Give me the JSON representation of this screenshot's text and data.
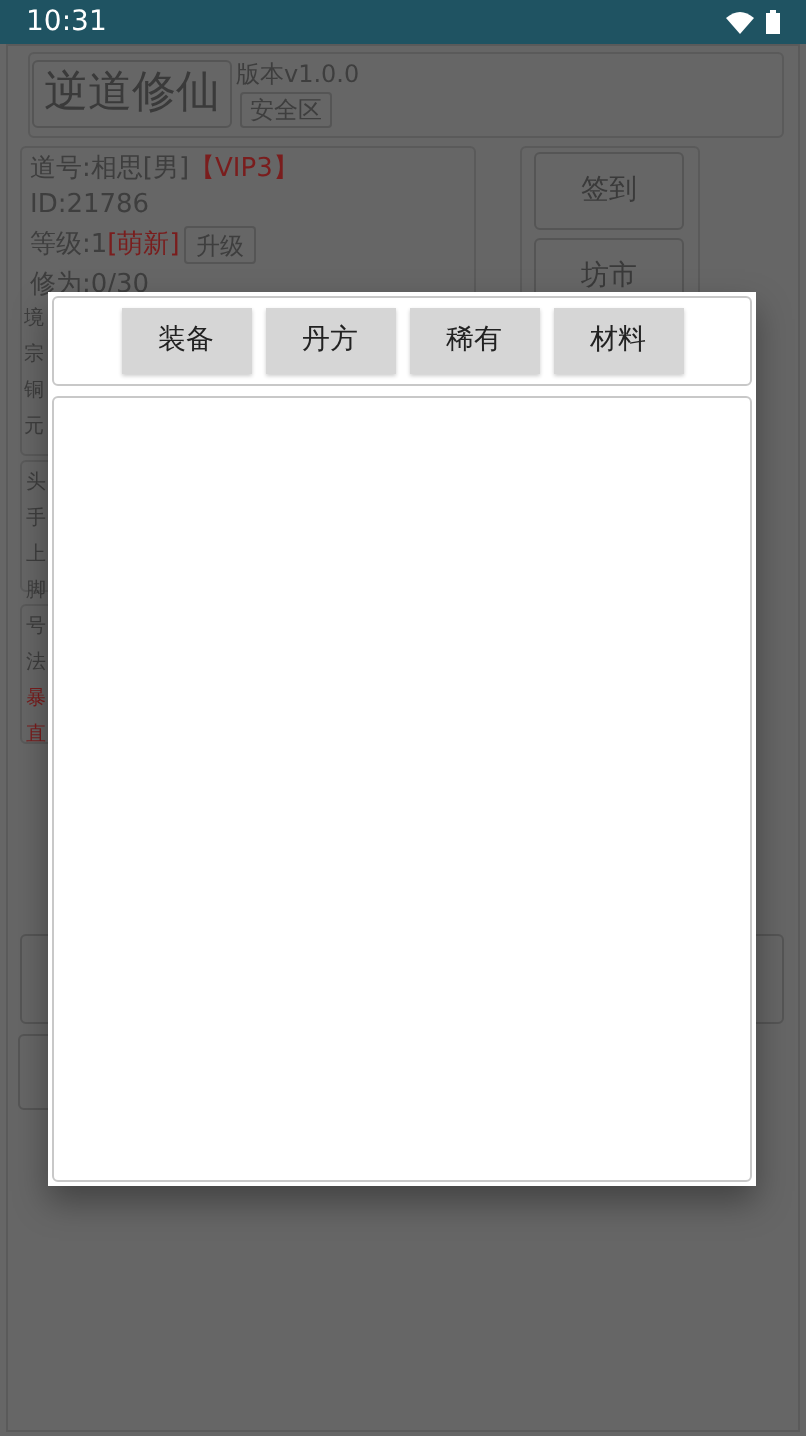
{
  "status_bar": {
    "time": "10:31"
  },
  "header": {
    "title": "逆道修仙",
    "version": "版本v1.0.0",
    "zone_button": "安全区"
  },
  "profile": {
    "name": "道号:相思[男]",
    "vip": "【VIP3】",
    "id": "ID:21786",
    "level": "等级:1",
    "level_tag": "[萌新]",
    "upgrade_button": "升级",
    "cultivation": "修为:0/30"
  },
  "partial_sections": [
    [
      {
        "text": "境",
        "highlighted": false
      },
      {
        "text": "宗",
        "highlighted": false
      },
      {
        "text": "铜",
        "highlighted": false
      },
      {
        "text": "元",
        "highlighted": false
      }
    ],
    [
      {
        "text": "头",
        "highlighted": false
      },
      {
        "text": "手",
        "highlighted": false
      },
      {
        "text": "上",
        "highlighted": false
      },
      {
        "text": "脚",
        "highlighted": false
      }
    ],
    [
      {
        "text": "号",
        "highlighted": false
      },
      {
        "text": "法",
        "highlighted": false
      },
      {
        "text": "暴",
        "highlighted": true
      },
      {
        "text": "直",
        "highlighted": true
      }
    ]
  ],
  "side_buttons": [
    "签到",
    "坊市"
  ],
  "dialog": {
    "tabs": [
      {
        "label": "装备",
        "selected": false
      },
      {
        "label": "丹方",
        "selected": false
      },
      {
        "label": "稀有",
        "selected": false
      },
      {
        "label": "材料",
        "selected": false
      }
    ]
  }
}
